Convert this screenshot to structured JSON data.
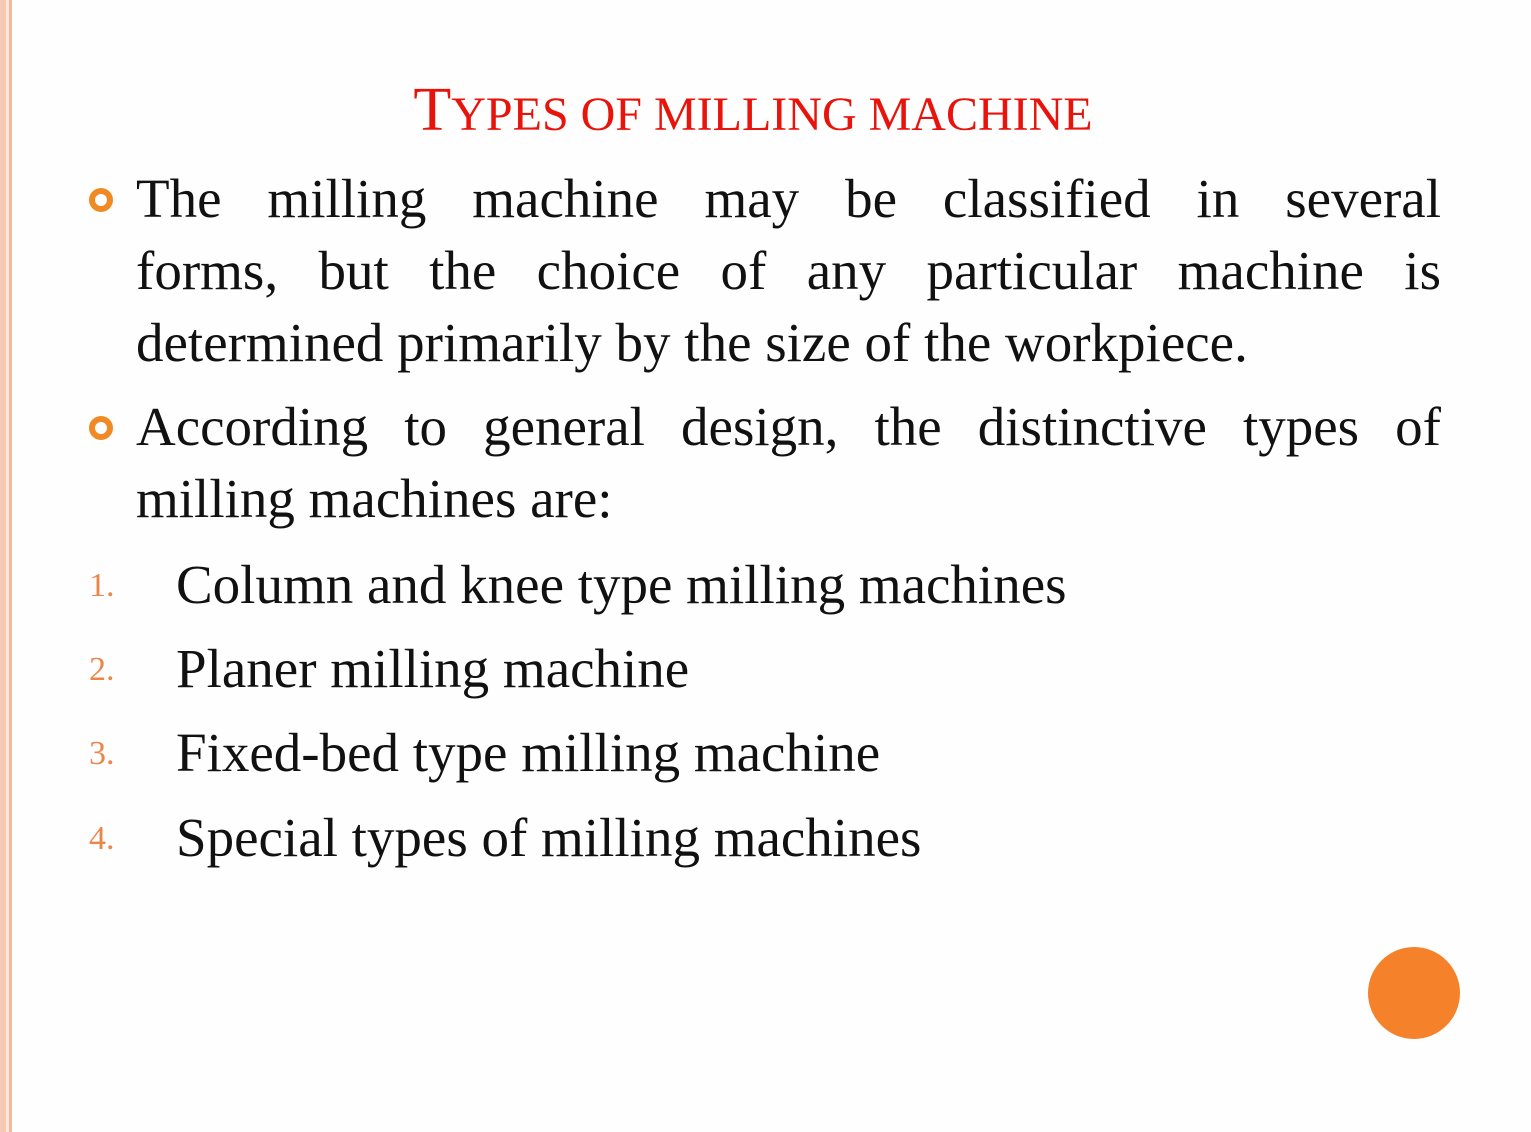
{
  "slide": {
    "title_first": "T",
    "title_rest": "YPES OF MILLING MACHINE",
    "bullets": [
      {
        "line1": "The milling machine may be classified in several",
        "line2": "forms, but the choice of any particular machine is",
        "line3": "determined primarily by the size of the workpiece."
      },
      {
        "line1": "According to general design, the distinctive types of",
        "line2": "milling machines are:"
      }
    ],
    "numbered": [
      {
        "num": "1.",
        "text": "Column and knee type milling machines"
      },
      {
        "num": "2.",
        "text": "Planer milling machine"
      },
      {
        "num": "3.",
        "text": "Fixed-bed type milling machine"
      },
      {
        "num": "4.",
        "text": "Special types of milling machines"
      }
    ],
    "colors": {
      "title": "#e8140c",
      "accent": "#f08a25",
      "circle": "#f5822b"
    }
  }
}
